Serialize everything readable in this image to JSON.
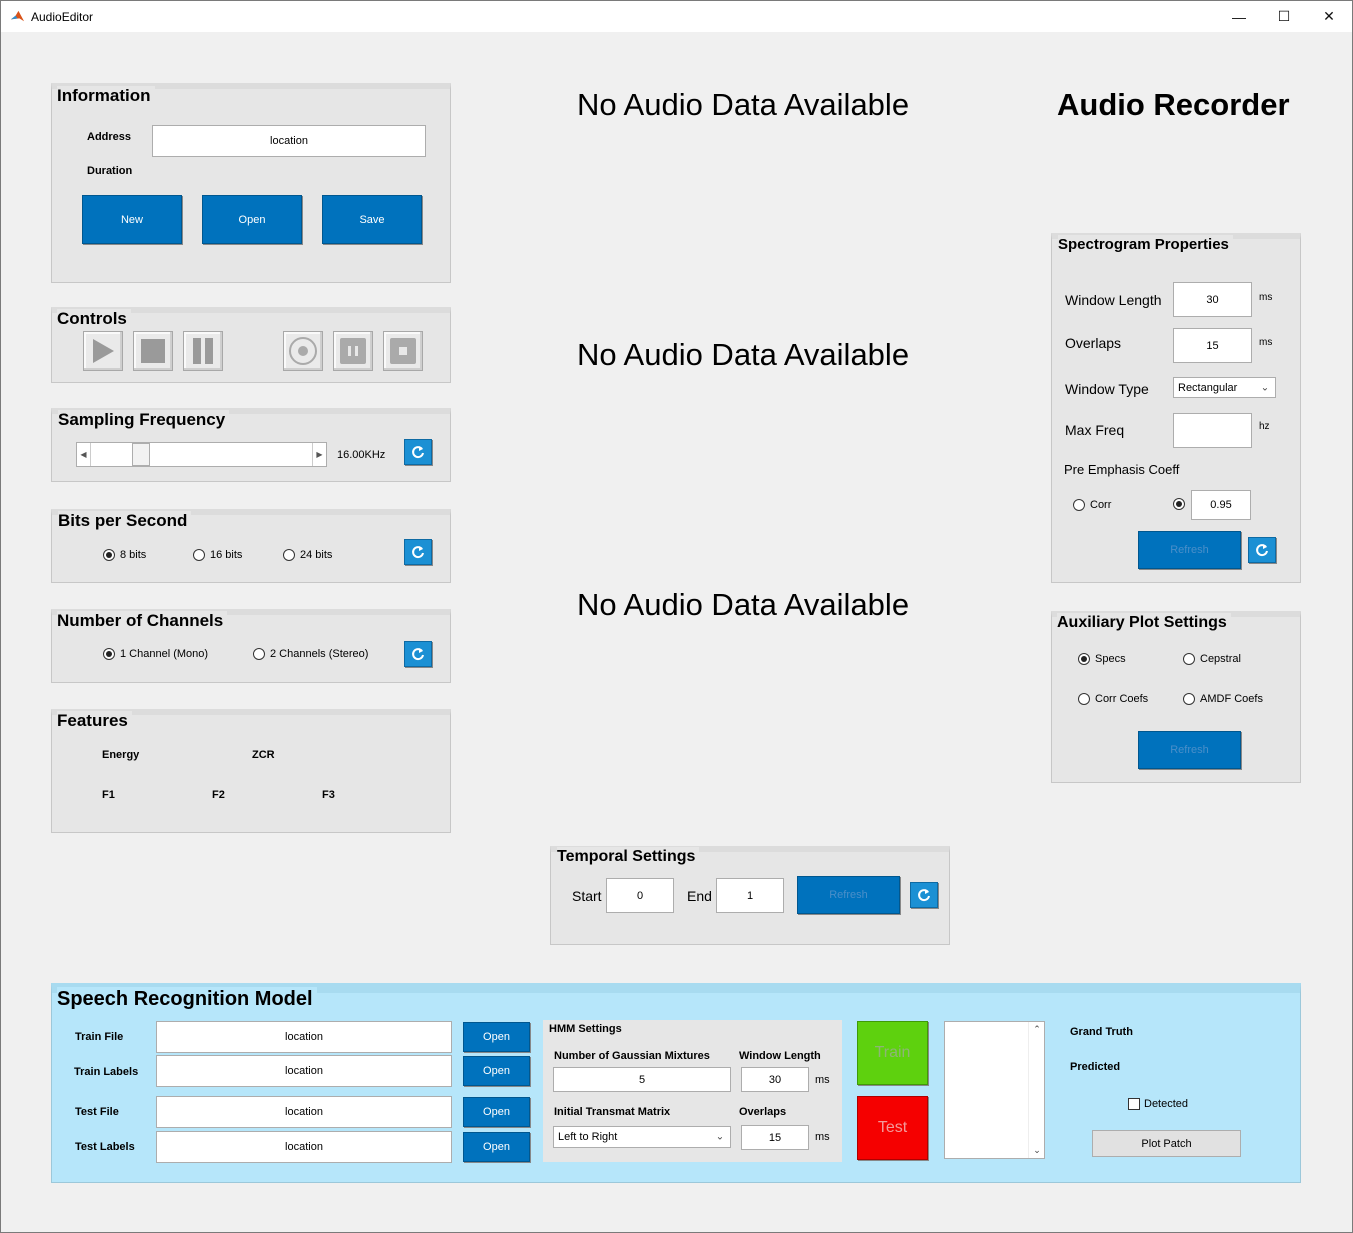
{
  "window": {
    "title": "AudioEditor",
    "min": "—",
    "max": "☐",
    "close": "✕"
  },
  "info": {
    "title": "Information",
    "address_label": "Address",
    "address_value": "location",
    "duration_label": "Duration",
    "new": "New",
    "open": "Open",
    "save": "Save"
  },
  "controls": {
    "title": "Controls",
    "icons": [
      "play-icon",
      "stop-icon",
      "pause-icon",
      "record-icon",
      "record-pause-icon",
      "record-stop-icon"
    ]
  },
  "sampling": {
    "title": "Sampling Frequency",
    "value_text": "16.00KHz",
    "level": 0.2
  },
  "bits": {
    "title": "Bits per Second",
    "options": [
      "8 bits",
      "16 bits",
      "24 bits"
    ],
    "selected": 0
  },
  "channels": {
    "title": "Number of Channels",
    "options": [
      "1 Channel (Mono)",
      "2 Channels (Stereo)"
    ],
    "selected": 0
  },
  "features": {
    "title": "Features",
    "energy": "Energy",
    "zcr": "ZCR",
    "f1": "F1",
    "f2": "F2",
    "f3": "F3"
  },
  "plots": {
    "p1": "No Audio Data Available",
    "p2": "No Audio Data Available",
    "p3": "No Audio Data Available"
  },
  "recorder": {
    "title": "Audio Recorder"
  },
  "spectrogram": {
    "title": "Spectrogram Properties",
    "window_length_label": "Window Length",
    "window_length": "30",
    "ms1": "ms",
    "overlaps_label": "Overlaps",
    "overlaps": "15",
    "ms2": "ms",
    "window_type_label": "Window Type",
    "window_type": "Rectangular",
    "max_freq_label": "Max Freq",
    "max_freq": "",
    "hz": "hz",
    "pre_emph_label": "Pre Emphasis Coeff",
    "corr": "Corr",
    "coeff": "0.95",
    "refresh": "Refresh"
  },
  "aux": {
    "title": "Auxiliary Plot Settings",
    "specs": "Specs",
    "cepstral": "Cepstral",
    "corr_coefs": "Corr Coefs",
    "amdf_coefs": "AMDF Coefs",
    "refresh": "Refresh"
  },
  "temporal": {
    "title": "Temporal Settings",
    "start_label": "Start",
    "start": "0",
    "end_label": "End",
    "end": "1",
    "refresh": "Refresh"
  },
  "speech": {
    "title": "Speech Recognition Model",
    "train_file_label": "Train File",
    "train_file": "location",
    "train_labels_label": "Train Labels",
    "train_labels": "location",
    "test_file_label": "Test File",
    "test_file": "location",
    "test_labels_label": "Test Labels",
    "test_labels": "location",
    "open": "Open",
    "hmm_title": "HMM Settings",
    "gauss_label": "Number of Gaussian Mixtures",
    "gauss": "5",
    "wl_label": "Window Length",
    "wl": "30",
    "ms": "ms",
    "transmat_label": "Initial Transmat Matrix",
    "transmat": "Left to Right",
    "ov_label": "Overlaps",
    "ov": "15",
    "train": "Train",
    "test": "Test",
    "grand_truth": "Grand Truth",
    "predicted": "Predicted",
    "detected": "Detected",
    "plot_patch": "Plot Patch",
    "colors": {
      "train": "#5ed10e",
      "test": "#f50000",
      "panel": "#b6e6fa"
    }
  }
}
